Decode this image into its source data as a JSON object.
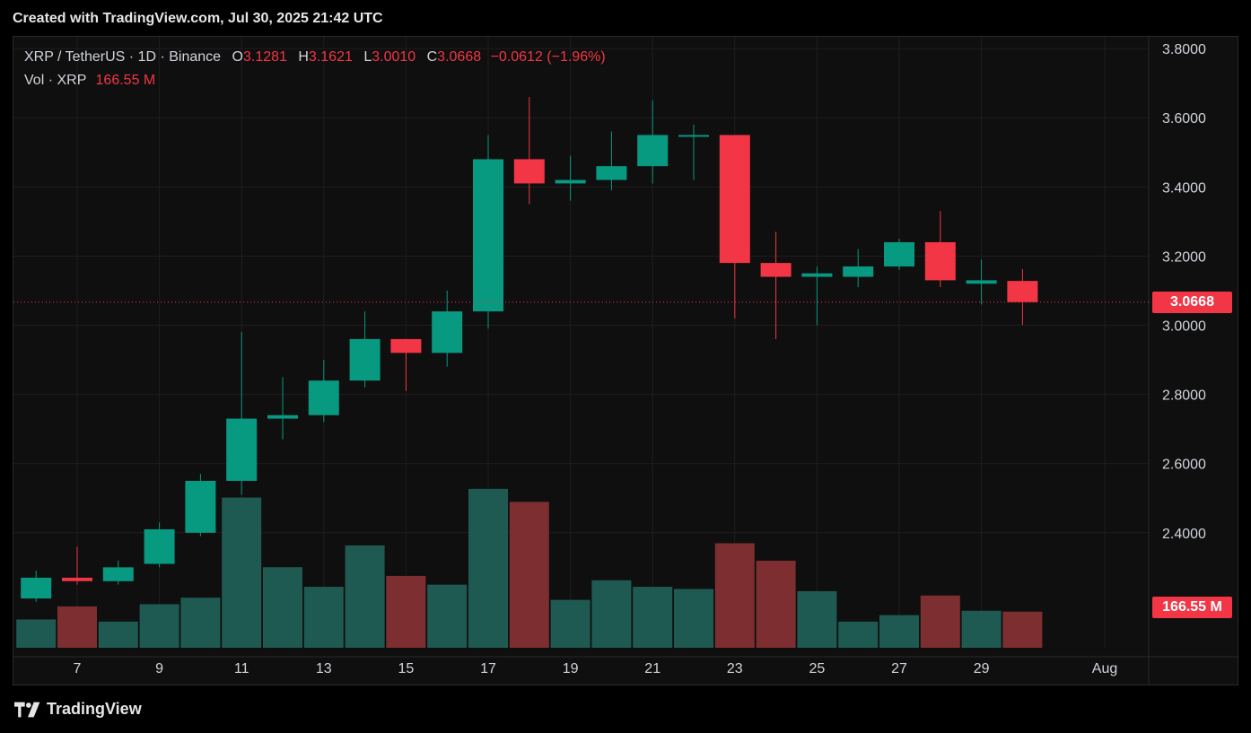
{
  "header": {
    "title": "Created with TradingView.com, Jul 30, 2025 21:42 UTC"
  },
  "legend": {
    "symbol": "XRP / TetherUS · 1D · Binance",
    "o_label": "O",
    "o_value": "3.1281",
    "h_label": "H",
    "h_value": "3.1621",
    "l_label": "L",
    "l_value": "3.0010",
    "c_label": "C",
    "c_value": "3.0668",
    "change": "−0.0612 (−1.96%)",
    "vol_label": "Vol · XRP",
    "vol_value": "166.55 M"
  },
  "price_tag": "3.0668",
  "volume_tag": "166.55 M",
  "footer": {
    "brand": "TradingView"
  },
  "colors": {
    "up": "#089981",
    "down": "#f23645",
    "up_vol": "#1f5a52",
    "down_vol": "#7d2e30"
  },
  "chart_data": {
    "type": "candlestick",
    "y_ticks": [
      "3.8000",
      "3.6000",
      "3.4000",
      "3.2000",
      "3.0000",
      "2.8000",
      "2.6000",
      "2.4000"
    ],
    "ylim": [
      2.2,
      3.84
    ],
    "x_ticks": [
      {
        "label": "7",
        "day": 7
      },
      {
        "label": "9",
        "day": 9
      },
      {
        "label": "11",
        "day": 11
      },
      {
        "label": "13",
        "day": 13
      },
      {
        "label": "15",
        "day": 15
      },
      {
        "label": "17",
        "day": 17
      },
      {
        "label": "19",
        "day": 19
      },
      {
        "label": "21",
        "day": 21
      },
      {
        "label": "23",
        "day": 23
      },
      {
        "label": "25",
        "day": 25
      },
      {
        "label": "27",
        "day": 27
      },
      {
        "label": "29",
        "day": 29
      },
      {
        "label": "Aug",
        "day": 32
      }
    ],
    "last_close": 3.0668,
    "candles": [
      {
        "day": 6,
        "o": 2.21,
        "h": 2.29,
        "l": 2.2,
        "c": 2.27,
        "vol": 0.13
      },
      {
        "day": 7,
        "o": 2.27,
        "h": 2.36,
        "l": 2.25,
        "c": 2.26,
        "vol": 0.19
      },
      {
        "day": 8,
        "o": 2.26,
        "h": 2.32,
        "l": 2.25,
        "c": 2.3,
        "vol": 0.12
      },
      {
        "day": 9,
        "o": 2.31,
        "h": 2.43,
        "l": 2.3,
        "c": 2.41,
        "vol": 0.2
      },
      {
        "day": 10,
        "o": 2.4,
        "h": 2.57,
        "l": 2.39,
        "c": 2.55,
        "vol": 0.23
      },
      {
        "day": 11,
        "o": 2.55,
        "h": 2.98,
        "l": 2.51,
        "c": 2.73,
        "vol": 0.69
      },
      {
        "day": 12,
        "o": 2.73,
        "h": 2.85,
        "l": 2.67,
        "c": 2.74,
        "vol": 0.37
      },
      {
        "day": 13,
        "o": 2.74,
        "h": 2.9,
        "l": 2.72,
        "c": 2.84,
        "vol": 0.28
      },
      {
        "day": 14,
        "o": 2.84,
        "h": 3.04,
        "l": 2.82,
        "c": 2.96,
        "vol": 0.47
      },
      {
        "day": 15,
        "o": 2.96,
        "h": 2.96,
        "l": 2.81,
        "c": 2.92,
        "vol": 0.33
      },
      {
        "day": 16,
        "o": 2.92,
        "h": 3.1,
        "l": 2.88,
        "c": 3.04,
        "vol": 0.29
      },
      {
        "day": 17,
        "o": 3.04,
        "h": 3.55,
        "l": 2.99,
        "c": 3.48,
        "vol": 0.73
      },
      {
        "day": 18,
        "o": 3.48,
        "h": 3.66,
        "l": 3.35,
        "c": 3.41,
        "vol": 0.67
      },
      {
        "day": 19,
        "o": 3.41,
        "h": 3.49,
        "l": 3.36,
        "c": 3.42,
        "vol": 0.22
      },
      {
        "day": 20,
        "o": 3.42,
        "h": 3.56,
        "l": 3.39,
        "c": 3.46,
        "vol": 0.31
      },
      {
        "day": 21,
        "o": 3.46,
        "h": 3.65,
        "l": 3.41,
        "c": 3.55,
        "vol": 0.28
      },
      {
        "day": 22,
        "o": 3.55,
        "h": 3.58,
        "l": 3.42,
        "c": 3.55,
        "vol": 0.27
      },
      {
        "day": 23,
        "o": 3.55,
        "h": 3.55,
        "l": 3.02,
        "c": 3.18,
        "vol": 0.48
      },
      {
        "day": 24,
        "o": 3.18,
        "h": 3.27,
        "l": 2.96,
        "c": 3.14,
        "vol": 0.4
      },
      {
        "day": 25,
        "o": 3.14,
        "h": 3.17,
        "l": 3.0,
        "c": 3.15,
        "vol": 0.26
      },
      {
        "day": 26,
        "o": 3.14,
        "h": 3.22,
        "l": 3.11,
        "c": 3.17,
        "vol": 0.12
      },
      {
        "day": 27,
        "o": 3.17,
        "h": 3.25,
        "l": 3.16,
        "c": 3.24,
        "vol": 0.15
      },
      {
        "day": 28,
        "o": 3.24,
        "h": 3.33,
        "l": 3.11,
        "c": 3.13,
        "vol": 0.24
      },
      {
        "day": 29,
        "o": 3.12,
        "h": 3.19,
        "l": 3.06,
        "c": 3.13,
        "vol": 0.17
      },
      {
        "day": 30,
        "o": 3.1281,
        "h": 3.1621,
        "l": 3.001,
        "c": 3.0668,
        "vol": 0.166
      }
    ]
  }
}
